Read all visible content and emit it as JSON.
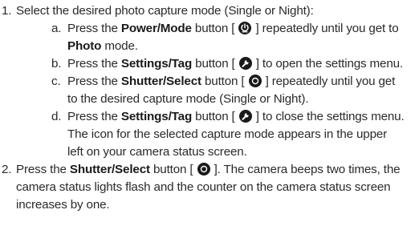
{
  "step1": {
    "number": "1.",
    "text": "Select the desired photo capture mode (Single or Night):",
    "substeps": [
      {
        "letter": "a.",
        "pre": "Press the ",
        "button_label": "Power/Mode",
        "mid": " button [ ",
        "icon": "power-mode-icon",
        "post_a": " ] repeatedly until you get to ",
        "bold2": "Photo",
        "post_b": " mode."
      },
      {
        "letter": "b.",
        "pre": "Press the ",
        "button_label": "Settings/Tag",
        "mid": " button [ ",
        "icon": "wrench-icon",
        "post": " ] to open the settings menu."
      },
      {
        "letter": "c.",
        "pre": "Press the ",
        "button_label": "Shutter/Select",
        "mid": " button [ ",
        "icon": "shutter-icon",
        "post": " ] repeatedly until you get to the desired capture mode (Single or Night)."
      },
      {
        "letter": "d.",
        "pre": "Press the ",
        "button_label": "Settings/Tag",
        "mid": " button [ ",
        "icon": "wrench-icon",
        "post": " ] to close the settings menu. The icon for the selected capture mode appears in the upper left on your camera status screen."
      }
    ]
  },
  "step2": {
    "number": "2.",
    "pre": "Press the ",
    "button_label": "Shutter/Select",
    "mid": " button [ ",
    "icon": "shutter-icon",
    "post": " ]. The camera beeps two times, the camera status lights flash and the counter on the camera status screen increases by one."
  }
}
